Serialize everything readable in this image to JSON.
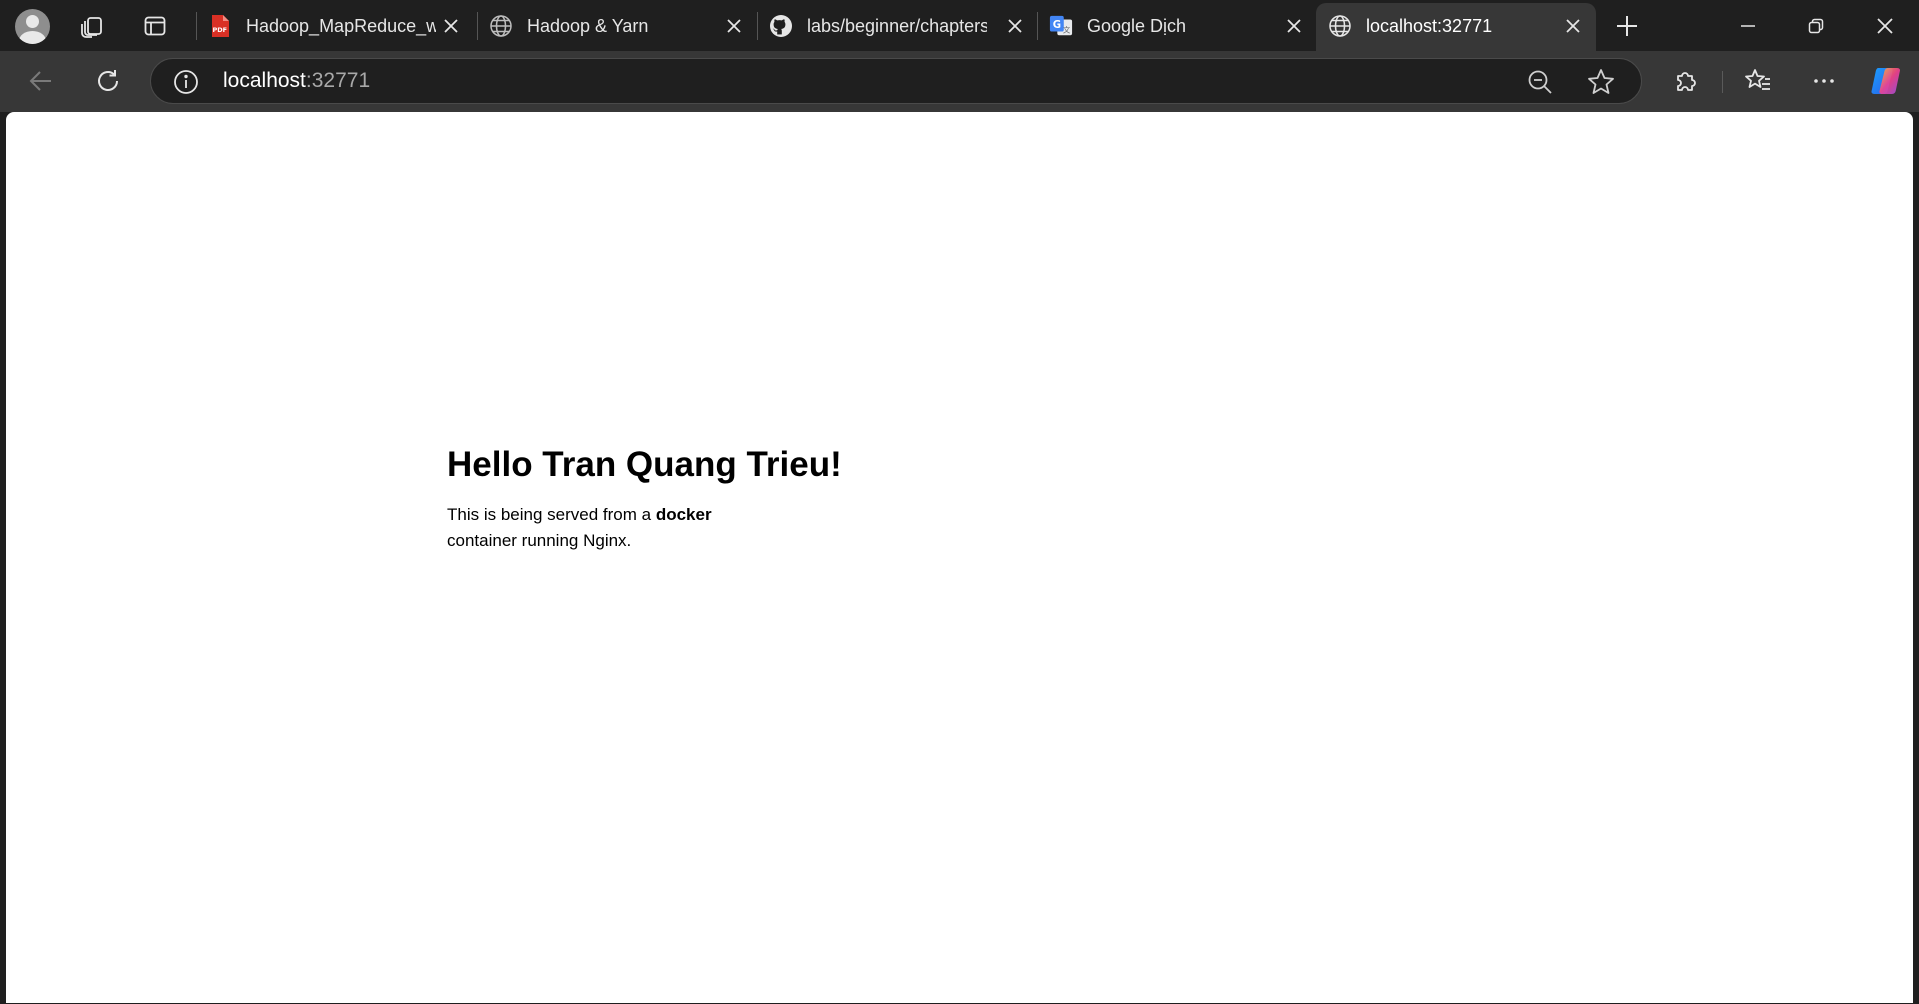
{
  "tabs": [
    {
      "title": "Hadoop_MapReduce_w",
      "icon": "pdf-icon"
    },
    {
      "title": "Hadoop & Yarn",
      "icon": "globe-icon"
    },
    {
      "title": "labs/beginner/chapters/",
      "icon": "github-icon"
    },
    {
      "title": "Google Dịch",
      "icon": "google-translate-icon"
    },
    {
      "title": "localhost:32771",
      "icon": "globe-icon",
      "active": true
    }
  ],
  "address_bar": {
    "host": "localhost",
    "port": ":32771"
  },
  "page": {
    "heading": "Hello Tran Quang Trieu!",
    "text_before": "This is being served from a ",
    "text_bold": "docker",
    "text_after": " container running Nginx."
  },
  "colors": {
    "chrome_dark": "#1f1f1f",
    "toolbar": "#373737",
    "page_bg": "#ffffff",
    "pdf_red": "#d93025"
  }
}
